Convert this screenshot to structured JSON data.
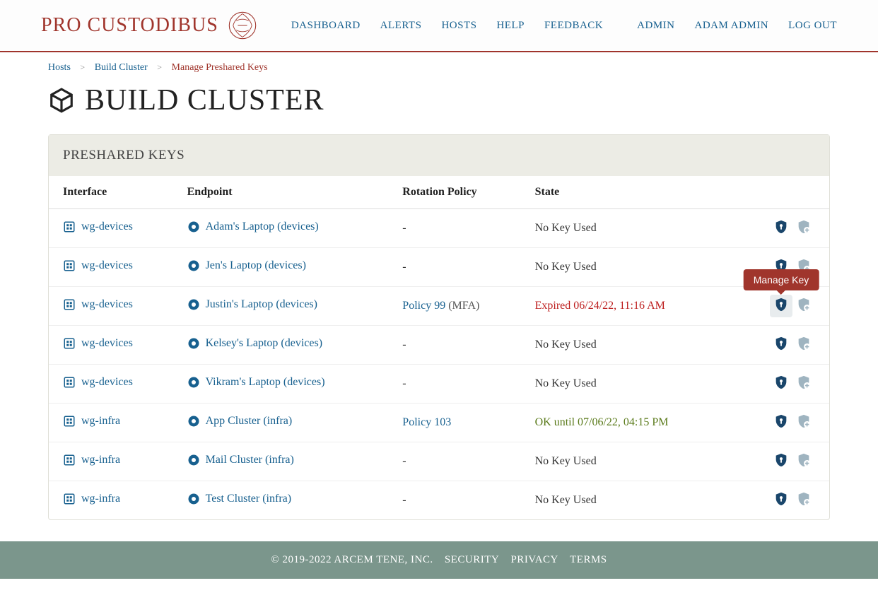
{
  "brand": "PRO CUSTODIBUS",
  "nav": {
    "dashboard": "DASHBOARD",
    "alerts": "ALERTS",
    "hosts": "HOSTS",
    "help": "HELP",
    "feedback": "FEEDBACK",
    "admin": "ADMIN",
    "user": "ADAM ADMIN",
    "logout": "LOG OUT"
  },
  "crumbs": {
    "hosts": "Hosts",
    "cluster": "Build Cluster",
    "current": "Manage Preshared Keys"
  },
  "page_title": "BUILD CLUSTER",
  "panel_title": "PRESHARED KEYS",
  "columns": {
    "interface": "Interface",
    "endpoint": "Endpoint",
    "policy": "Rotation Policy",
    "state": "State"
  },
  "tooltip": "Manage Key",
  "rows": [
    {
      "interface": "wg-devices",
      "endpoint": "Adam's Laptop (devices)",
      "policy": "-",
      "policy_link": "",
      "policy_suffix": "",
      "state": "No Key Used",
      "state_class": ""
    },
    {
      "interface": "wg-devices",
      "endpoint": "Jen's Laptop (devices)",
      "policy": "-",
      "policy_link": "",
      "policy_suffix": "",
      "state": "No Key Used",
      "state_class": ""
    },
    {
      "interface": "wg-devices",
      "endpoint": "Justin's Laptop (devices)",
      "policy": "",
      "policy_link": "Policy 99",
      "policy_suffix": " (MFA)",
      "state": "Expired 06/24/22, 11:16 AM",
      "state_class": "state-expired"
    },
    {
      "interface": "wg-devices",
      "endpoint": "Kelsey's Laptop (devices)",
      "policy": "-",
      "policy_link": "",
      "policy_suffix": "",
      "state": "No Key Used",
      "state_class": ""
    },
    {
      "interface": "wg-devices",
      "endpoint": "Vikram's Laptop (devices)",
      "policy": "-",
      "policy_link": "",
      "policy_suffix": "",
      "state": "No Key Used",
      "state_class": ""
    },
    {
      "interface": "wg-infra",
      "endpoint": "App Cluster (infra)",
      "policy": "",
      "policy_link": "Policy 103",
      "policy_suffix": "",
      "state": "OK until 07/06/22, 04:15 PM",
      "state_class": "state-ok"
    },
    {
      "interface": "wg-infra",
      "endpoint": "Mail Cluster (infra)",
      "policy": "-",
      "policy_link": "",
      "policy_suffix": "",
      "state": "No Key Used",
      "state_class": ""
    },
    {
      "interface": "wg-infra",
      "endpoint": "Test Cluster (infra)",
      "policy": "-",
      "policy_link": "",
      "policy_suffix": "",
      "state": "No Key Used",
      "state_class": ""
    }
  ],
  "footer": {
    "copyright": "© 2019-2022 ARCEM TENE, INC.",
    "security": "SECURITY",
    "privacy": "PRIVACY",
    "terms": "TERMS"
  }
}
